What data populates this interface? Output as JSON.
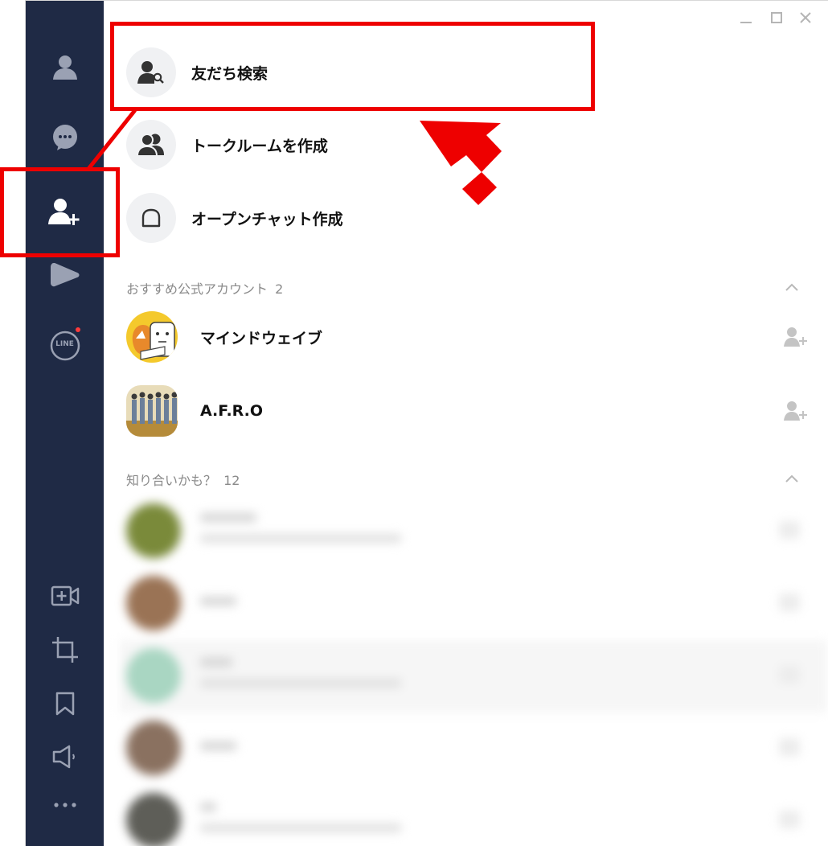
{
  "window_controls": [
    "minimize",
    "maximize",
    "close"
  ],
  "sidebar": {
    "icons": [
      "friends-icon",
      "chats-icon",
      "add-friends-icon",
      "line-voom-icon",
      "line-news-icon",
      "video-call-icon",
      "crop-icon",
      "bookmark-icon",
      "announcement-icon",
      "more-icon"
    ],
    "line_badge_text": "LINE"
  },
  "menu": {
    "items": [
      {
        "label": "友だち検索",
        "icon": "person-search-icon"
      },
      {
        "label": "トークルームを作成",
        "icon": "group-icon"
      },
      {
        "label": "オープンチャット作成",
        "icon": "open-chat-icon"
      }
    ]
  },
  "recommended": {
    "header": "おすすめ公式アカウント",
    "count": "2",
    "accounts": [
      {
        "name": "マインドウェイブ"
      },
      {
        "name": "A.F.R.O"
      }
    ]
  },
  "maybe_know": {
    "header": "知り合いかも？",
    "count": "12"
  },
  "colors": {
    "sidebar_bg": "#1f2a45",
    "highlight": "#ee0000",
    "menu_circle": "#f0f1f3"
  }
}
